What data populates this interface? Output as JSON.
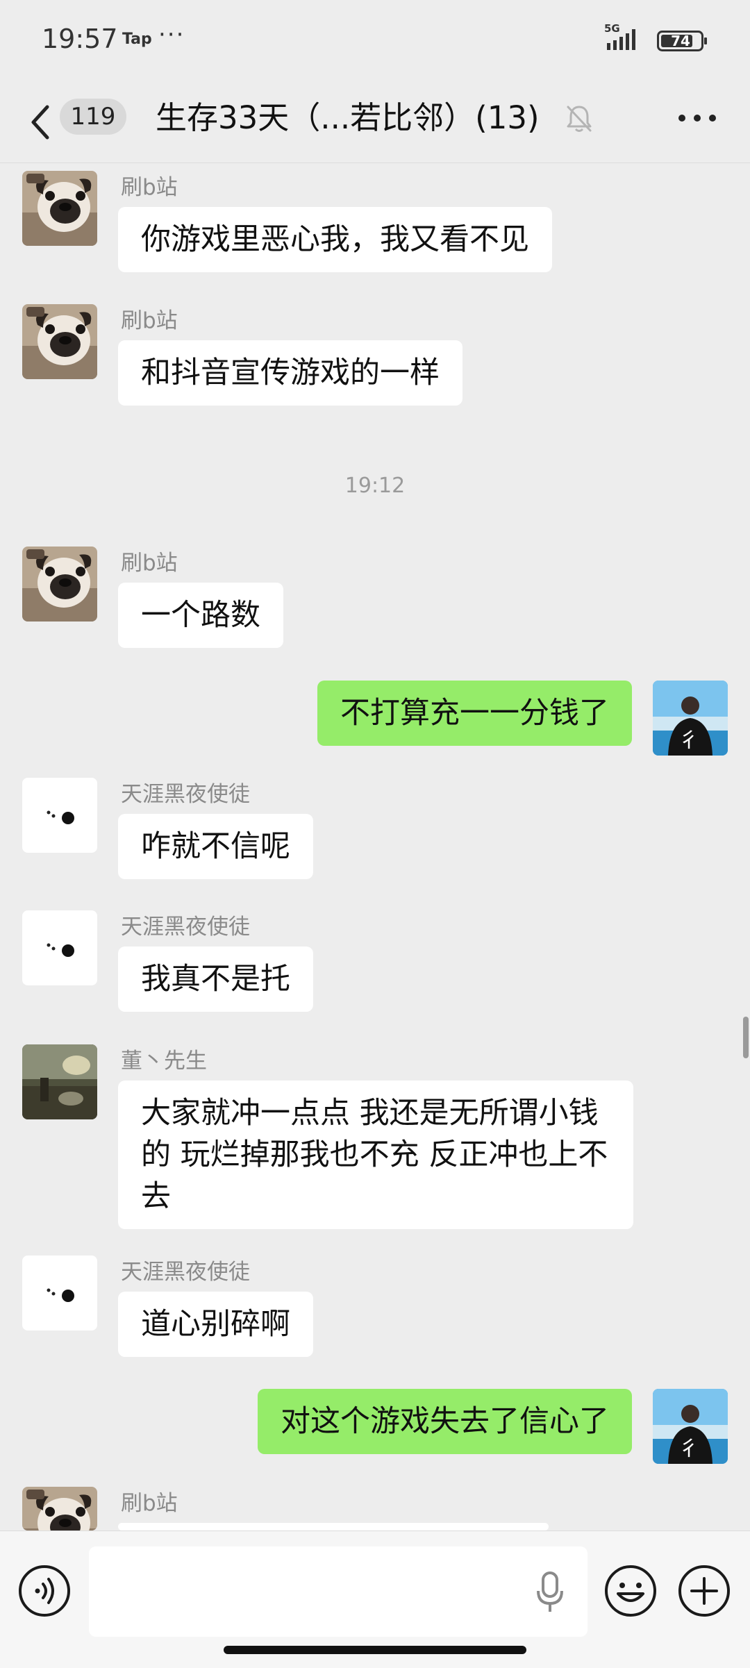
{
  "status_bar": {
    "time": "19:57",
    "app_label": "Tap",
    "more_dots": "···",
    "network": "5G",
    "battery": "74"
  },
  "header": {
    "back_icon": "chevron-left-icon",
    "unread_count": "119",
    "title": "生存33天（...若比邻）(13)",
    "mute_icon": "bell-muted-icon",
    "more_icon": "more-dots-icon"
  },
  "messages": [
    {
      "sender": "刷b站",
      "text": "你游戏里恶心我，我又看不见",
      "avatar": "pug-avatar"
    },
    {
      "sender": "刷b站",
      "text": "和抖音宣传游戏的一样",
      "avatar": "pug-avatar"
    },
    {
      "timestamp": "19:12"
    },
    {
      "sender": "刷b站",
      "text": "一个路数",
      "avatar": "pug-avatar"
    },
    {
      "outgoing": true,
      "text": "不打算充一一分钱了",
      "avatar": "self-avatar"
    },
    {
      "sender": "天涯黑夜使徒",
      "text": "咋就不信呢",
      "avatar": "dots-avatar"
    },
    {
      "sender": "天涯黑夜使徒",
      "text": "我真不是托",
      "avatar": "dots-avatar"
    },
    {
      "sender": "董丶先生",
      "text": "大家就冲一点点 我还是无所谓小钱的 玩烂掉那我也不充 反正冲也上不去",
      "avatar": "landscape-avatar"
    },
    {
      "sender": "天涯黑夜使徒",
      "text": "道心别碎啊",
      "avatar": "dots-avatar"
    },
    {
      "outgoing": true,
      "text": "对这个游戏失去了信心了",
      "avatar": "self-avatar"
    },
    {
      "sender": "刷b站",
      "text": "",
      "avatar": "pug-avatar"
    }
  ],
  "input_bar": {
    "voice_icon": "voice-icon",
    "text_value": "",
    "mic_icon": "mic-icon",
    "emoji_icon": "emoji-icon",
    "plus_icon": "plus-icon"
  },
  "colors": {
    "background": "#ededed",
    "incoming_bubble": "#ffffff",
    "outgoing_bubble": "#95ec69"
  }
}
